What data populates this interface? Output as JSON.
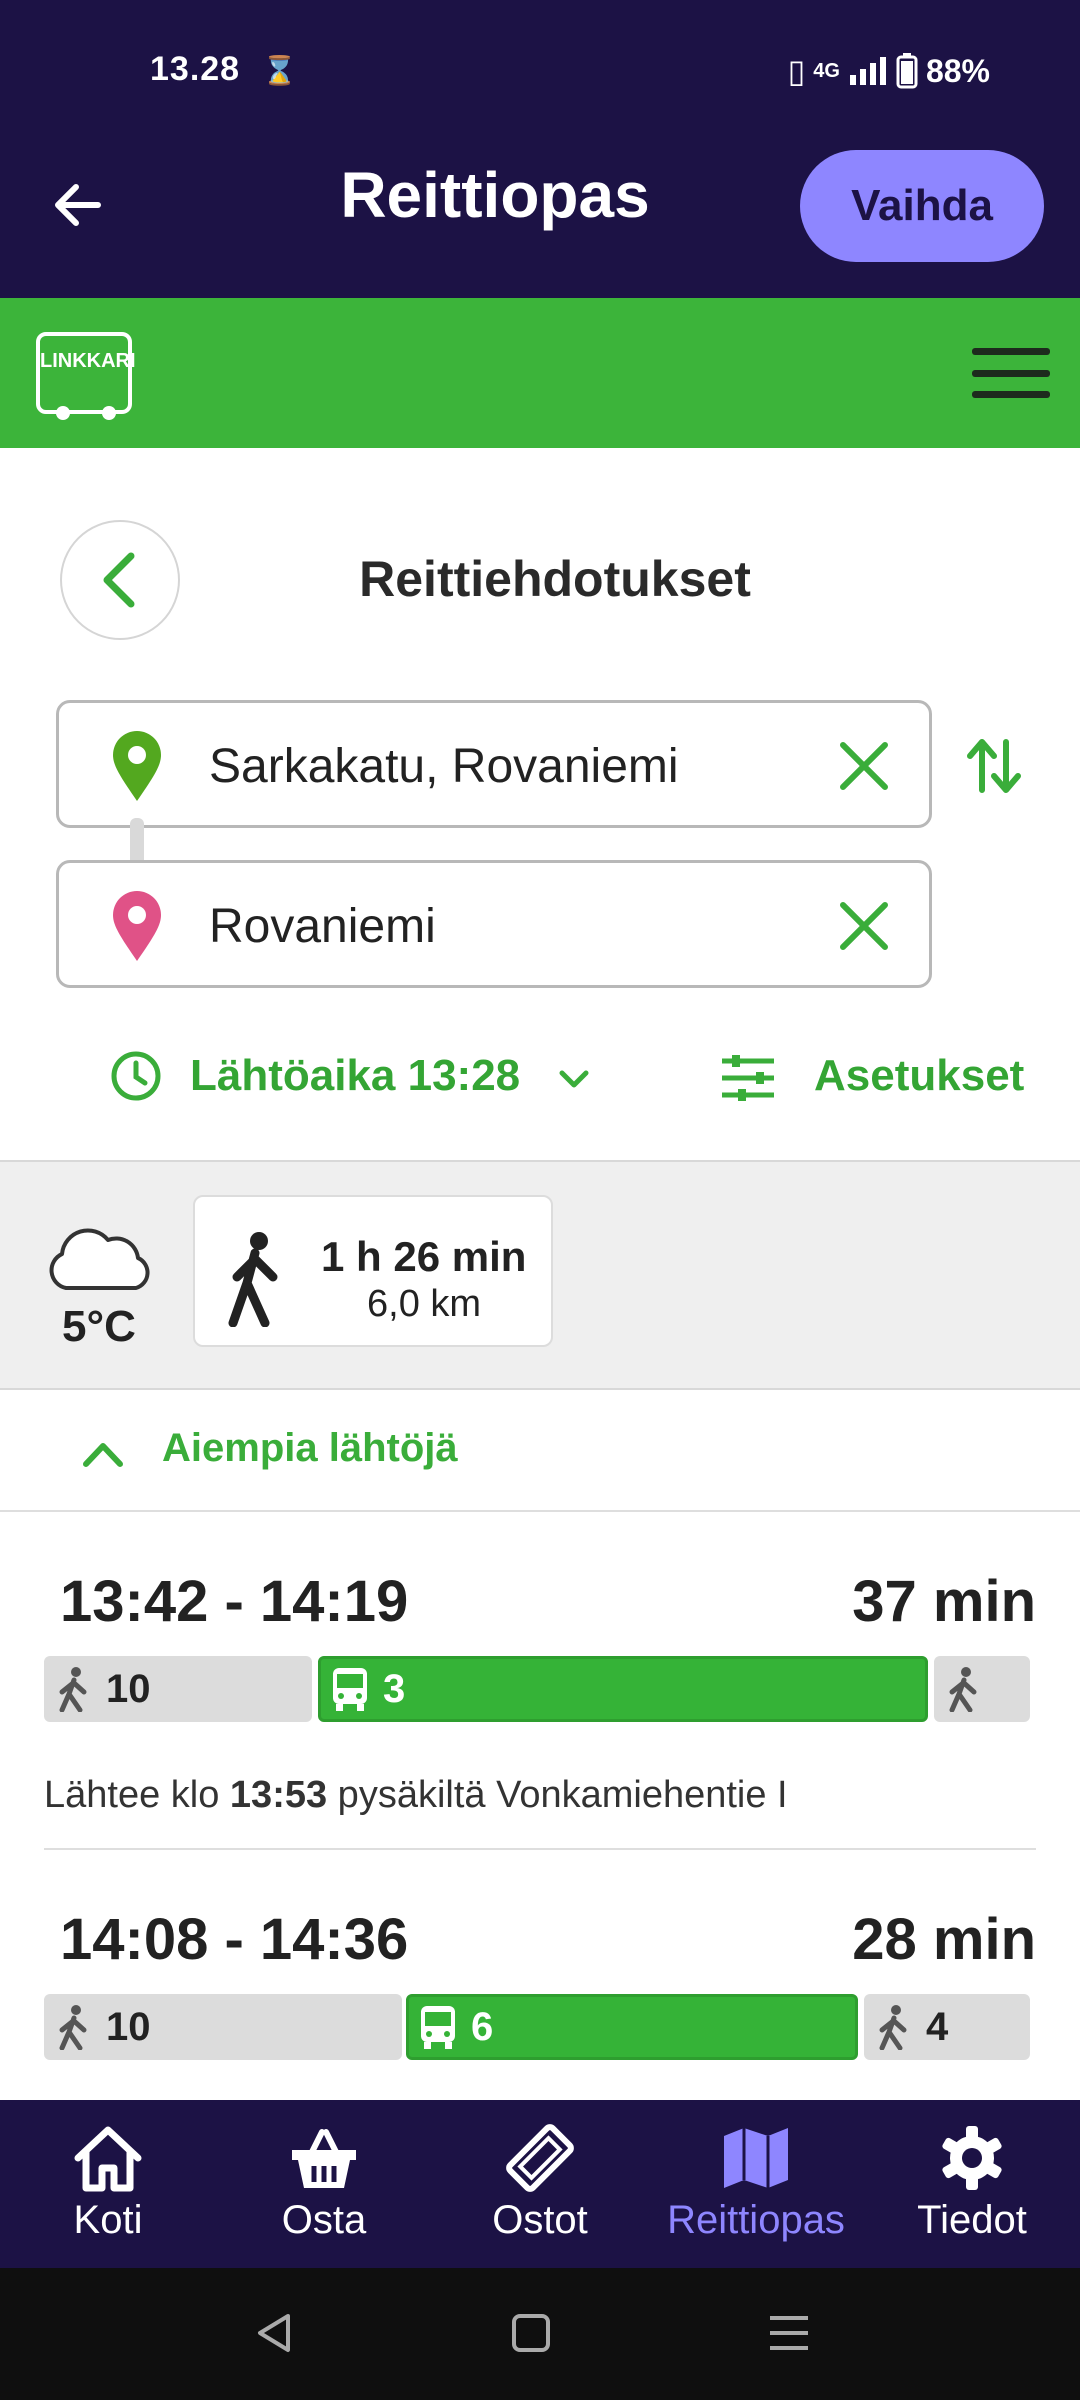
{
  "status": {
    "time": "13.28",
    "signal_label": "4G",
    "battery": "88%"
  },
  "header": {
    "title": "Reittiopas",
    "change_button": "Vaihda"
  },
  "brand": {
    "logo_text": "LINKKARI",
    "accent": "#3cb43a",
    "dark": "#1c1245"
  },
  "page": {
    "title": "Reittiehdotukset"
  },
  "from": {
    "value": "Sarkakatu, Rovaniemi",
    "pin_color": "#53a81f"
  },
  "to": {
    "value": "Rovaniemi",
    "pin_color": "#e05287"
  },
  "options": {
    "departure": "Lähtöaika 13:28",
    "settings": "Asetukset"
  },
  "weather": {
    "temperature": "5°C",
    "icon": "cloud-icon"
  },
  "walk_only": {
    "duration": "1 h 26 min",
    "distance": "6,0 km"
  },
  "earlier": "Aiempia lähtöjä",
  "routes": [
    {
      "times": "13:42 - 14:19",
      "duration": "37 min",
      "legs": [
        {
          "type": "walk",
          "label": "10"
        },
        {
          "type": "bus",
          "label": "3"
        },
        {
          "type": "walk",
          "label": ""
        }
      ],
      "desc_prefix": "Lähtee klo ",
      "desc_time": "13:53",
      "desc_suffix": " pysäkiltä Vonkamiehentie I"
    },
    {
      "times": "14:08 - 14:36",
      "duration": "28 min",
      "legs": [
        {
          "type": "walk",
          "label": "10"
        },
        {
          "type": "bus",
          "label": "6"
        },
        {
          "type": "walk",
          "label": "4"
        }
      ]
    }
  ],
  "nav": [
    {
      "label": "Koti",
      "icon": "home-icon"
    },
    {
      "label": "Osta",
      "icon": "basket-icon"
    },
    {
      "label": "Ostot",
      "icon": "ticket-icon"
    },
    {
      "label": "Reittiopas",
      "icon": "map-icon",
      "active": true
    },
    {
      "label": "Tiedot",
      "icon": "gear-icon"
    }
  ]
}
